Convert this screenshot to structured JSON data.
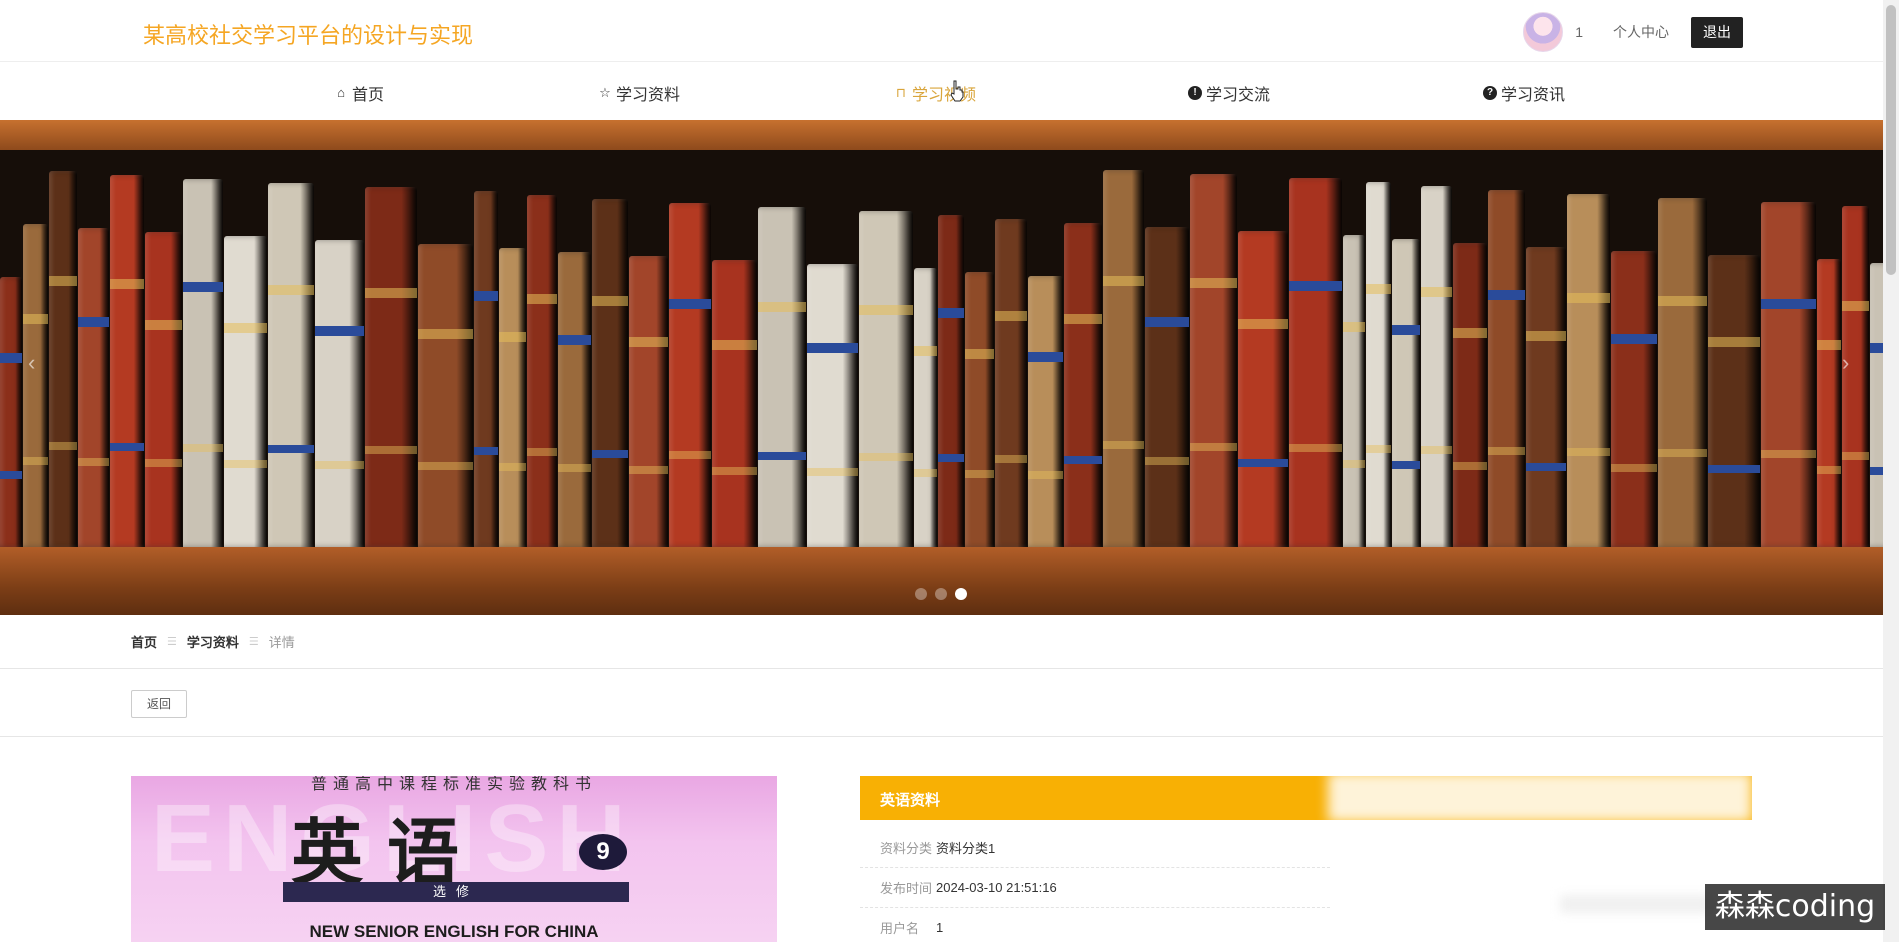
{
  "header": {
    "site_title": "某高校社交学习平台的设计与实现",
    "username": "1",
    "personal_center": "个人中心",
    "logout": "退出"
  },
  "nav": {
    "items": [
      {
        "label": "首页",
        "icon": "home-icon"
      },
      {
        "label": "学习资料",
        "icon": "star-icon"
      },
      {
        "label": "学习视频",
        "icon": "bag-icon",
        "active": true
      },
      {
        "label": "学习交流",
        "icon": "exclamation-circle-icon"
      },
      {
        "label": "学习资讯",
        "icon": "question-circle-icon"
      }
    ]
  },
  "banner": {
    "slides_count": 3,
    "active_slide": 3
  },
  "breadcrumb": {
    "home": "首页",
    "section": "学习资料",
    "current": "详情",
    "separator": "☰"
  },
  "actions": {
    "back": "返回"
  },
  "cover": {
    "top_line": "普通高中课程标准实验教科书",
    "title": "英语",
    "volume": "9",
    "band": "选修",
    "english": "NEW SENIOR ENGLISH FOR CHINA"
  },
  "detail": {
    "title": "英语资料",
    "rows": [
      {
        "label": "资料分类",
        "value": "资料分类1"
      },
      {
        "label": "发布时间",
        "value": "2024-03-10 21:51:16"
      },
      {
        "label": "用户名",
        "value": "1"
      }
    ]
  },
  "watermark": "森森coding",
  "colors": {
    "brand_title": "#f5a623",
    "accent_bar": "#f8b004",
    "nav_active": "#d9a53b"
  }
}
